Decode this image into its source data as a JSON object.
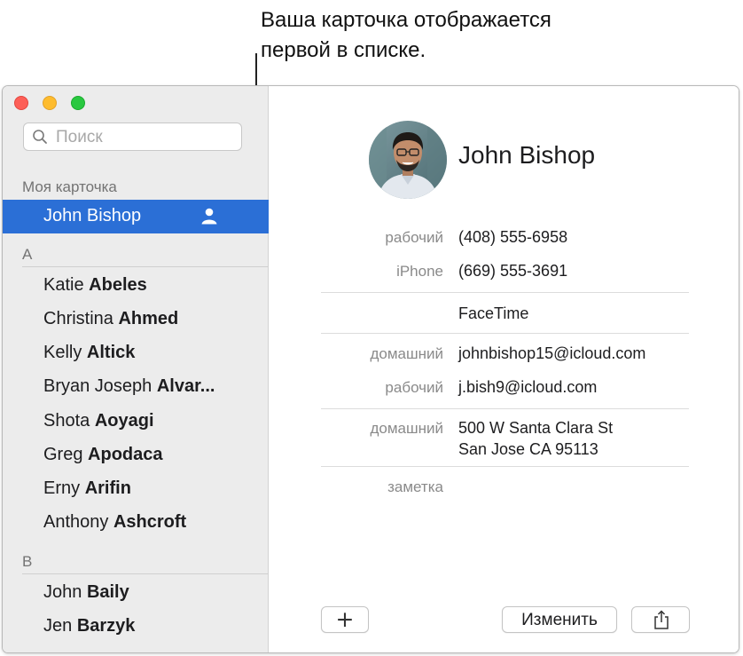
{
  "callout": {
    "line1": "Ваша карточка отображается",
    "line2": "первой в списке."
  },
  "sidebar": {
    "search_placeholder": "Поиск",
    "my_card_label": "Моя карточка",
    "my_card_name": "John Bishop",
    "groups": [
      {
        "letter": "A",
        "contacts": [
          {
            "first": "Katie ",
            "last": "Abeles"
          },
          {
            "first": "Christina ",
            "last": "Ahmed"
          },
          {
            "first": "Kelly ",
            "last": "Altick"
          },
          {
            "first": "Bryan Joseph ",
            "last": "Alvar..."
          },
          {
            "first": "Shota ",
            "last": "Aoyagi"
          },
          {
            "first": "Greg ",
            "last": "Apodaca"
          },
          {
            "first": "Erny ",
            "last": "Arifin"
          },
          {
            "first": "Anthony ",
            "last": "Ashcroft"
          }
        ]
      },
      {
        "letter": "B",
        "contacts": [
          {
            "first": "John ",
            "last": "Baily"
          },
          {
            "first": "Jen ",
            "last": "Barzyk"
          }
        ]
      }
    ]
  },
  "detail": {
    "name": "John Bishop",
    "fields": {
      "phone_work_label": "рабочий",
      "phone_work_value": "(408) 555-6958",
      "phone_iphone_label": "iPhone",
      "phone_iphone_value": "(669) 555-3691",
      "facetime_value": "FaceTime",
      "email_home_label": "домашний",
      "email_home_value": "johnbishop15@icloud.com",
      "email_work_label": "рабочий",
      "email_work_value": "j.bish9@icloud.com",
      "address_home_label": "домашний",
      "address_line1": "500 W Santa Clara St",
      "address_line2": "San Jose CA 95113",
      "note_label": "заметка"
    },
    "buttons": {
      "add": "+",
      "edit": "Изменить"
    }
  },
  "colors": {
    "selection": "#2b6fd6",
    "close": "#fd5f57",
    "minimize": "#febc2e",
    "maximize": "#29c840"
  },
  "icons": [
    "search-icon",
    "me-card-icon",
    "share-icon",
    "contact-photo"
  ]
}
